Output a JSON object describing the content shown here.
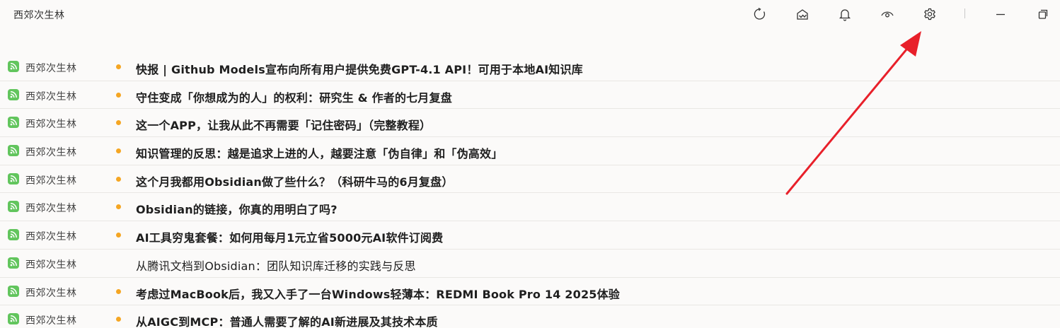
{
  "app": {
    "title": "西郊次生林"
  },
  "toolbar": {
    "buttons": [
      {
        "name": "refresh-icon"
      },
      {
        "name": "mark-all-read-icon"
      },
      {
        "name": "bell-icon"
      },
      {
        "name": "eye-icon"
      },
      {
        "name": "gear-icon"
      },
      {
        "name": "minimize-icon"
      },
      {
        "name": "restore-window-icon"
      }
    ]
  },
  "colors": {
    "feed_icon": "#62c55d",
    "unread_dot": "#f5a623",
    "arrow": "#e8202a"
  },
  "articles": [
    {
      "feed": "西郊次生林",
      "title": "快报 | Github Models宣布向所有用户提供免费GPT-4.1 API！可用于本地AI知识库",
      "unread": true
    },
    {
      "feed": "西郊次生林",
      "title": "守住变成「你想成为的人」的权利：研究生 & 作者的七月复盘",
      "unread": true
    },
    {
      "feed": "西郊次生林",
      "title": "这一个APP，让我从此不再需要「记住密码」（完整教程）",
      "unread": true
    },
    {
      "feed": "西郊次生林",
      "title": "知识管理的反思：越是追求上进的人，越要注意「伪自律」和「伪高效」",
      "unread": true
    },
    {
      "feed": "西郊次生林",
      "title": "这个月我都用Obsidian做了些什么？（科研牛马的6月复盘）",
      "unread": true
    },
    {
      "feed": "西郊次生林",
      "title": "Obsidian的链接，你真的用明白了吗?",
      "unread": true
    },
    {
      "feed": "西郊次生林",
      "title": "AI工具穷鬼套餐：如何用每月1元立省5000元AI软件订阅费",
      "unread": true
    },
    {
      "feed": "西郊次生林",
      "title": "从腾讯文档到Obsidian：团队知识库迁移的实践与反思",
      "unread": false
    },
    {
      "feed": "西郊次生林",
      "title": "考虑过MacBook后，我又入手了一台Windows轻薄本：REDMI Book Pro 14 2025体验",
      "unread": true
    },
    {
      "feed": "西郊次生林",
      "title": "从AIGC到MCP：普通人需要了解的AI新进展及其技术本质",
      "unread": true
    }
  ]
}
